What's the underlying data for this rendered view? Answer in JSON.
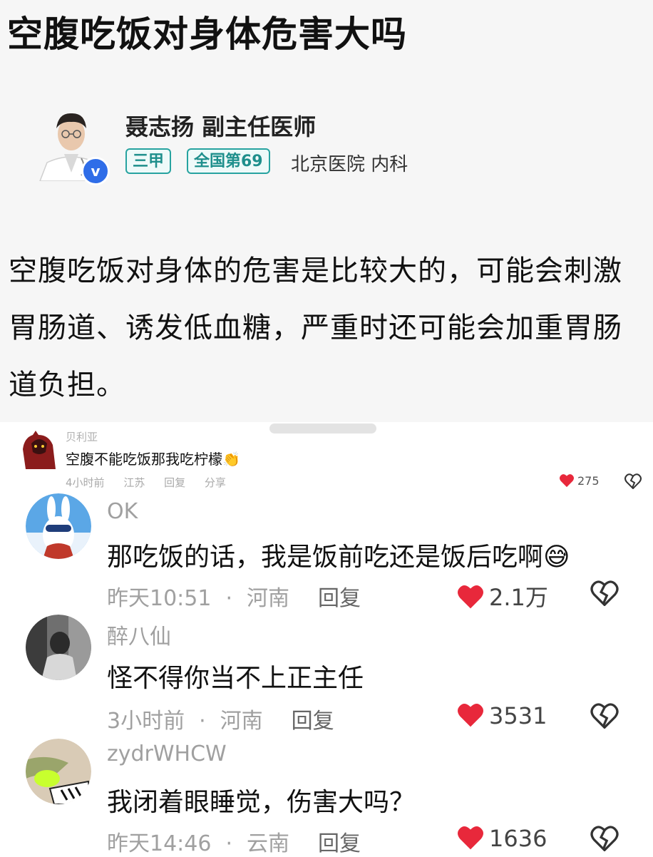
{
  "article": {
    "title": "空腹吃饭对身体危害大吗",
    "doctor": {
      "name": "聂志扬 副主任医师",
      "tag_level": "三甲",
      "tag_rank": "全国第69",
      "hospital": "北京医院 内科",
      "verified_mark": "v"
    },
    "answer": "空腹吃饭对身体的危害是比较大的，可能会刺激胃肠道、诱发低血糖，严重时还可能会加重胃肠道负担。"
  },
  "top_comment": {
    "username": "贝利亚",
    "text": "空腹不能吃饭那我吃柠檬👏",
    "time": "4小时前",
    "location": "江苏",
    "reply": "回复",
    "share": "分享",
    "likes": "275"
  },
  "comments": [
    {
      "username": "OK",
      "text": "那吃饭的话，我是饭前吃还是饭后吃啊😅",
      "time": "昨天10:51",
      "dot": "·",
      "location": "河南",
      "reply": "回复",
      "likes": "2.1万"
    },
    {
      "username": "醉八仙",
      "text": "怪不得你当不上正主任",
      "time": "3小时前",
      "dot": "·",
      "location": "河南",
      "reply": "回复",
      "likes": "3531"
    },
    {
      "username": "zydrWHCW",
      "text": "我闭着眼睡觉，伤害大吗？",
      "time": "昨天14:46",
      "dot": "·",
      "location": "云南",
      "reply": "回复",
      "likes": "1636"
    }
  ],
  "colors": {
    "heart": "#e8283b",
    "tag": "#27a3a0",
    "verified": "#2f6de8"
  }
}
